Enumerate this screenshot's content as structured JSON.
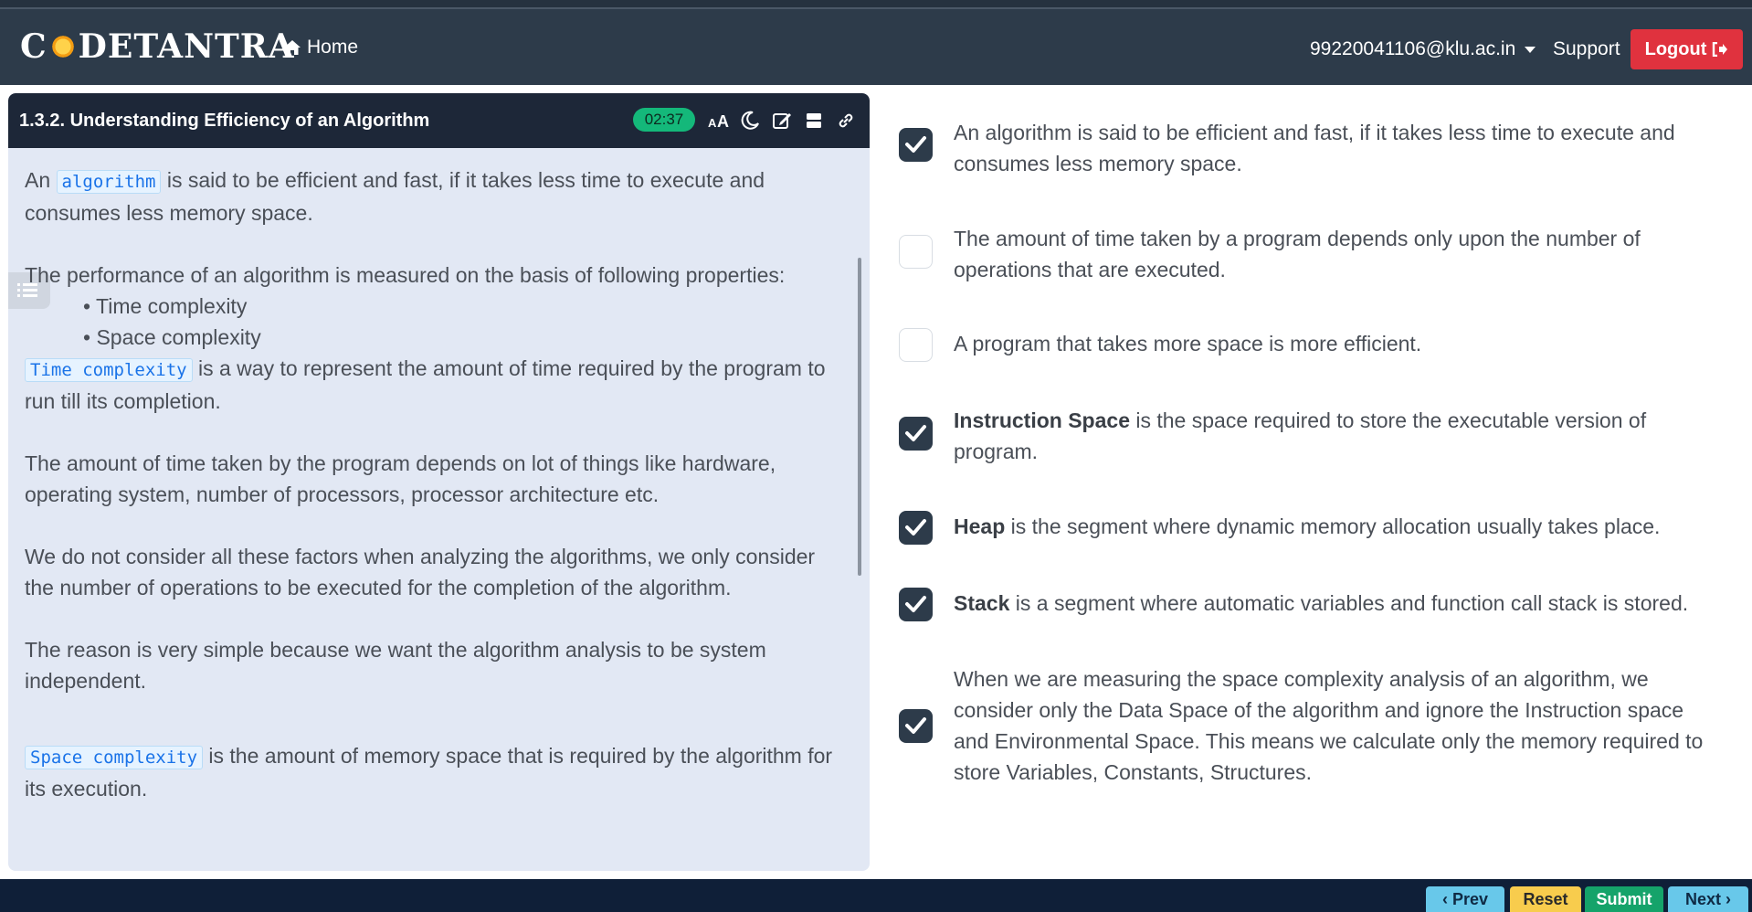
{
  "navbar": {
    "brand": "CODETANTRA",
    "home_label": "Home",
    "user_email": "99220041106@klu.ac.in",
    "support_label": "Support",
    "logout_label": "Logout"
  },
  "lesson": {
    "title": "1.3.2. Understanding Efficiency of an Algorithm",
    "timer": "02:37",
    "para1_prefix": "An",
    "para1_code": "algorithm",
    "para1_rest": " is said to be efficient and fast, if it takes less time to execute and consumes less memory space.",
    "para2": "The performance of an algorithm is measured on the basis of following properties:",
    "bullets": [
      "Time complexity",
      "Space complexity"
    ],
    "para3_code": "Time complexity",
    "para3_rest": " is a way to represent the amount of time required by the program to run till its completion.",
    "para4": "The amount of time taken by the program depends on lot of things like hardware, operating system, number of processors, processor architecture etc.",
    "para5": "We do not consider all these factors when analyzing the algorithms, we only consider the number of operations to be executed for the completion of the algorithm.",
    "para6": "The reason is very simple because we want the algorithm analysis to be system independent.",
    "para7_code": "Space complexity",
    "para7_rest": " is the amount of memory space that is required by the algorithm for its execution."
  },
  "options": [
    {
      "bold": "",
      "text": "An algorithm is said to be efficient and fast, if it takes less time to execute and consumes less memory space.",
      "checked": true
    },
    {
      "bold": "",
      "text": "The amount of time taken by a program depends only upon the number of operations that are executed.",
      "checked": false
    },
    {
      "bold": "",
      "text": "A program that takes more space is more efficient.",
      "checked": false
    },
    {
      "bold": "Instruction Space",
      "text": " is the space required to store the executable version of program.",
      "checked": true
    },
    {
      "bold": "Heap",
      "text": " is the segment where dynamic memory allocation usually takes place.",
      "checked": true
    },
    {
      "bold": "Stack",
      "text": " is a segment where automatic variables and function call stack is stored.",
      "checked": true
    },
    {
      "bold": "",
      "text": "When we are measuring the space complexity analysis of an algorithm, we consider only the Data Space of the algorithm and ignore the Instruction space and Environmental Space. This means we calculate only the memory required to store Variables, Constants, Structures.",
      "checked": true
    }
  ],
  "footer": {
    "prev_label": "Prev",
    "reset_label": "Reset",
    "submit_label": "Submit",
    "next_label": "Next"
  },
  "colors": {
    "navbar": "#2d3b4a",
    "card_header": "#1d2738",
    "timer": "#14b87a",
    "logout": "#e0323e",
    "submit": "#15a36a",
    "reset": "#f8cc4d",
    "nav_buttons": "#68c8ea"
  }
}
